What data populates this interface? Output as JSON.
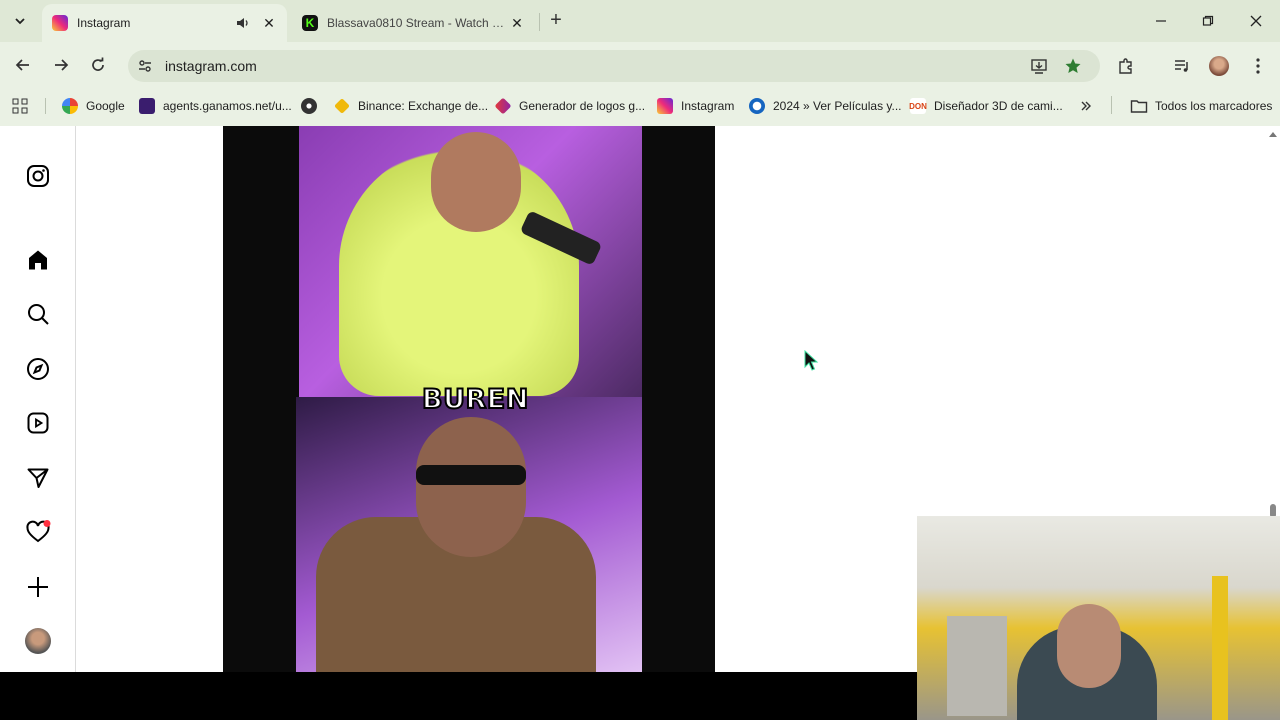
{
  "browser": {
    "tabs": [
      {
        "title": "Instagram",
        "active": true
      },
      {
        "title": "Blassava0810 Stream - Watch Live",
        "active": false
      }
    ],
    "url": "instagram.com",
    "bookmarks": [
      {
        "label": "Google"
      },
      {
        "label": "agents.ganamos.net/u..."
      },
      {
        "label": ""
      },
      {
        "label": "Binance: Exchange de..."
      },
      {
        "label": "Generador de logos g..."
      },
      {
        "label": "Instagram"
      },
      {
        "label": "2024 » Ver Películas y..."
      },
      {
        "label": "Diseñador 3D de cami..."
      }
    ],
    "all_bookmarks_label": "Todos los marcadores"
  },
  "reel": {
    "caption": "BUREN"
  },
  "colors": {
    "chrome_bg": "#eaf1e4",
    "tabstrip_bg": "#dfe8d6",
    "bookmark_star": "#2e7d32",
    "notification_dot": "#ff3040"
  }
}
